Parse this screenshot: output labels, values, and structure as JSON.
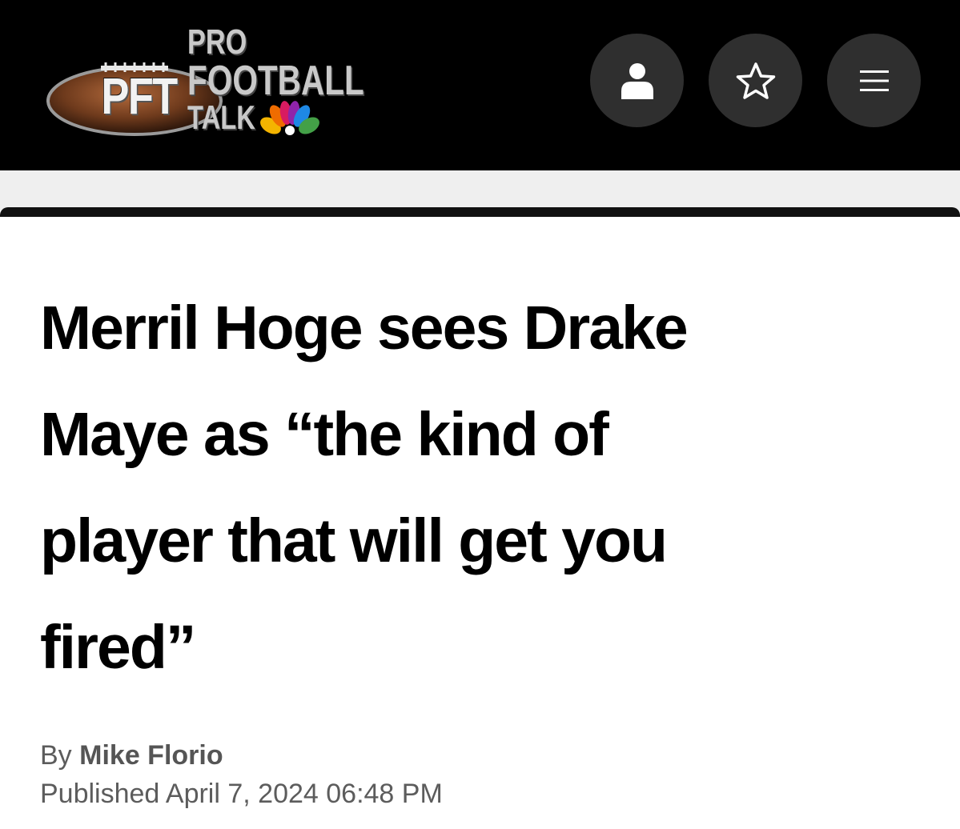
{
  "header": {
    "logo": {
      "pft": "PFT",
      "line1": "PRO",
      "line2": "FOOTBALL",
      "line3": "TALK",
      "brand_icon": "nbc-peacock"
    },
    "buttons": [
      {
        "name": "account",
        "icon": "user-icon"
      },
      {
        "name": "favorite",
        "icon": "star-icon"
      },
      {
        "name": "menu",
        "icon": "hamburger-menu-icon"
      }
    ],
    "colors": {
      "background": "#000000",
      "button": "#2f2f2f"
    }
  },
  "article": {
    "headline_lines": [
      "Merril Hoge sees Drake",
      "Maye as “the kind of",
      "player that will get you",
      "fired”"
    ],
    "byline_prefix": "By",
    "author": "Mike Florio",
    "published": "Published April 7, 2024 06:48 PM"
  }
}
